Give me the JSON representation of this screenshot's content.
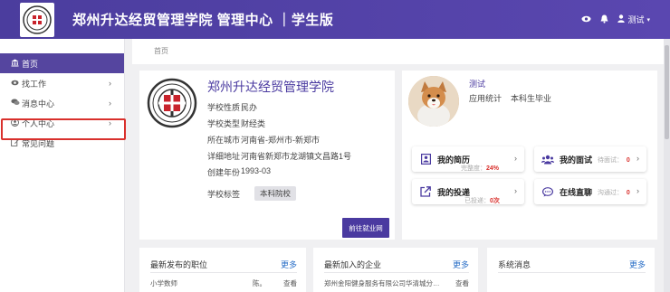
{
  "header": {
    "title": "郑州升达经贸管理学院 管理中心 ｜学生版",
    "user_label": "测试",
    "icons": [
      "eye-icon",
      "bell-icon",
      "user-icon",
      "caret-down-icon"
    ]
  },
  "sidebar": {
    "items": [
      {
        "label": "首页",
        "icon": "bank-icon",
        "active": true
      },
      {
        "label": "找工作",
        "icon": "eye-icon",
        "has_arrow": true
      },
      {
        "label": "消息中心",
        "icon": "chat-icon",
        "has_arrow": true
      },
      {
        "label": "个人中心",
        "icon": "user-circle-icon",
        "has_arrow": true,
        "highlighted": true
      },
      {
        "label": "常见问题",
        "icon": "edit-icon"
      }
    ]
  },
  "breadcrumb": {
    "label": "首页"
  },
  "school": {
    "name": "郑州升达经贸管理学院",
    "rows": [
      {
        "key": "学校性质",
        "value": "民办"
      },
      {
        "key": "学校类型",
        "value": "财经类"
      },
      {
        "key": "所在城市",
        "value": "河南省-郑州市-新郑市"
      },
      {
        "key": "详细地址",
        "value": "河南省新郑市龙湖镇文昌路1号"
      },
      {
        "key": "创建年份",
        "value": "1993-03"
      }
    ],
    "tag_key": "学校标签",
    "tag_value": "本科院校",
    "button_label": "前往就业网"
  },
  "user": {
    "name": "测试",
    "major": "应用统计",
    "degree": "本科生毕业",
    "quick": {
      "resume": {
        "label": "我的简历",
        "sub_label": "完整度：",
        "sub_value": "24%"
      },
      "interview": {
        "label": "我的面试",
        "sub_label": "待面试：",
        "sub_value": "0"
      },
      "delivery": {
        "label": "我的投递",
        "sub_label": "已投递：",
        "sub_value": "0次"
      },
      "online": {
        "label": "在线直聊",
        "sub_label": "沟通过：",
        "sub_value": "0"
      }
    }
  },
  "sections": {
    "jobs": {
      "title": "最新发布的职位",
      "more": "更多",
      "row_a": "小学数师",
      "row_b": "陈。",
      "row_c": "查看"
    },
    "companies": {
      "title": "最新加入的企业",
      "more": "更多",
      "row_a": "郑州金阳健身服务有限公司华清城分…",
      "row_c": "查看"
    },
    "messages": {
      "title": "系统消息",
      "more": "更多"
    }
  },
  "colors": {
    "brand": "#4b3d9e",
    "active": "#55459f",
    "highlight": "#d9302c",
    "link": "#2a6fc7"
  }
}
